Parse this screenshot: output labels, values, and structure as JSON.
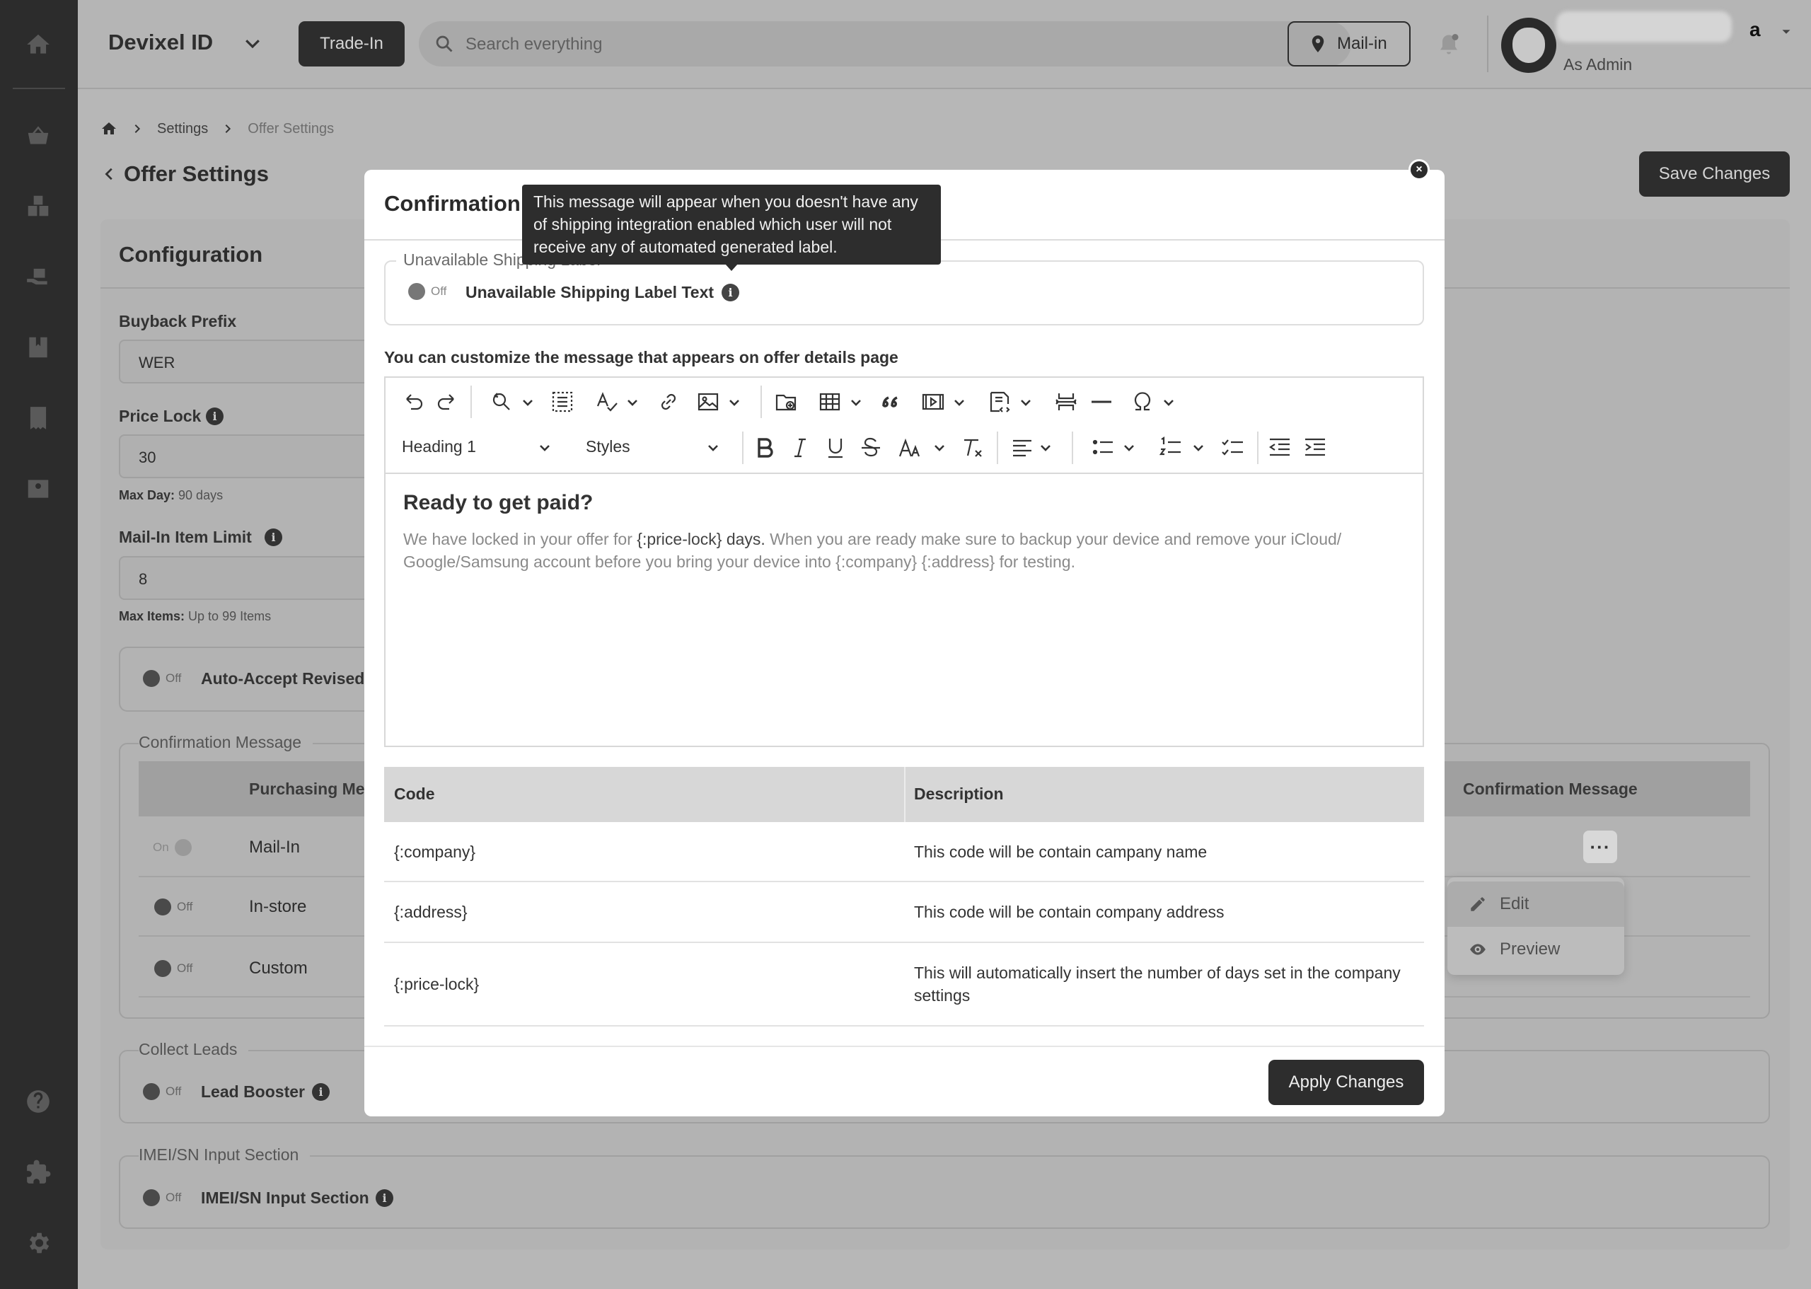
{
  "header": {
    "brand": "Devixel ID",
    "trade_in": "Trade-In",
    "search_placeholder": "Search everything",
    "mail_in": "Mail-in",
    "user_name_tail": "a",
    "user_role": "As Admin"
  },
  "breadcrumb": {
    "settings": "Settings",
    "current": "Offer Settings"
  },
  "page": {
    "title": "Offer Settings",
    "save_label": "Save Changes",
    "card_title": "Configuration"
  },
  "form": {
    "buyback_prefix_label": "Buyback Prefix",
    "buyback_prefix_value": "WER",
    "price_lock_label": "Price Lock",
    "price_lock_value": "30",
    "price_lock_hint_key": "Max Day:",
    "price_lock_hint_val": " 90 days",
    "mailin_limit_label": "Mail-In Item Limit",
    "mailin_limit_value": "8",
    "mailin_hint_key": "Max Items:",
    "mailin_hint_val": " Up to 99 Items",
    "auto_accept_label": "Auto-Accept Revised"
  },
  "toggles": {
    "off": "Off",
    "on": "On"
  },
  "confirmation_table": {
    "legend": "Confirmation Message",
    "col_method": "Purchasing Me",
    "col_message": "Confirmation Message",
    "rows": [
      {
        "method": "Mail-In",
        "state": "On"
      },
      {
        "method": "In-store",
        "state": "Off"
      },
      {
        "method": "Custom",
        "state": "Off"
      }
    ],
    "menu": {
      "edit": "Edit",
      "preview": "Preview"
    }
  },
  "collect_leads": {
    "legend": "Collect Leads",
    "label": "Lead Booster"
  },
  "imei": {
    "legend": "IMEI/SN Input Section",
    "label": "IMEI/SN Input Section"
  },
  "modal": {
    "title": "Confirmation",
    "close": "×",
    "fieldset_legend": "Unavailable Shipping Label",
    "toggle_label": "Unavailable Shipping Label Text",
    "tooltip": "This message will appear when you doesn't have any of shipping integration enabled which user will not receive any of automated generated label.",
    "description": "You can customize the message that appears on offer details page",
    "toolbar": {
      "heading": "Heading 1",
      "styles": "Styles"
    },
    "editor": {
      "heading": "Ready to get paid?",
      "p1": "We have locked in your offer for ",
      "p2": "{:price-lock} days.",
      "p3": " When you are ready make sure to backup your device and remove your iCloud/ Google/Samsung account before you bring your device into {:company} {:address} for testing."
    },
    "codes": {
      "col_code": "Code",
      "col_desc": "Description",
      "rows": [
        {
          "code": "{:company}",
          "desc": "This code will be contain campany name"
        },
        {
          "code": "{:address}",
          "desc": "This code will be contain company address"
        },
        {
          "code": "{:price-lock}",
          "desc": "This will automatically insert the number of days set in the company settings"
        }
      ]
    },
    "apply_label": "Apply Changes"
  },
  "colors": {
    "sidebar": "#2c2c2c",
    "overlay_bg": "#b7b7b7",
    "dark_button": "#2d2d2d",
    "modal_bg": "#ffffff"
  }
}
